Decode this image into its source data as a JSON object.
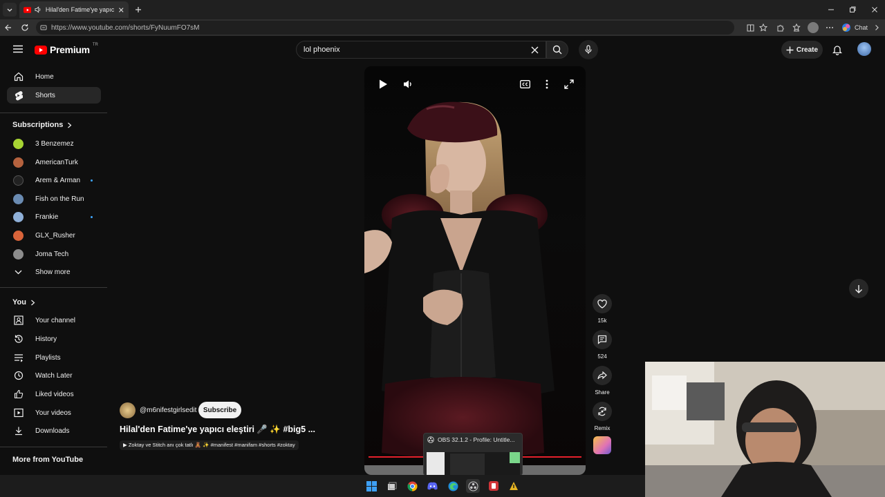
{
  "browser": {
    "tab_title": "Hilal'den Fatime'ye yapıcı eleştiri",
    "url": "https://www.youtube.com/shorts/FyNuumFO7sM",
    "chat_label": "Chat"
  },
  "header": {
    "logo_text": "Premium",
    "logo_country": "TR",
    "search_value": "lol phoenix",
    "create_label": "Create"
  },
  "sidebar": {
    "home": "Home",
    "shorts": "Shorts",
    "subscriptions_title": "Subscriptions",
    "subscriptions": [
      {
        "name": "3 Benzemez",
        "color": "#a7d433"
      },
      {
        "name": "AmericanTurk",
        "color": "#b5623e"
      },
      {
        "name": "Arem & Arman",
        "color": "#222222"
      },
      {
        "name": "Fish on the Run",
        "color": "#6a8bb2"
      },
      {
        "name": "Frankie",
        "color": "#8fb0d8"
      },
      {
        "name": "GLX_Rusher",
        "color": "#d9643a"
      },
      {
        "name": "Joma Tech",
        "color": "#8c8c8c"
      }
    ],
    "show_more": "Show more",
    "you_title": "You",
    "you_items": [
      "Your channel",
      "History",
      "Playlists",
      "Watch Later",
      "Liked videos",
      "Your videos",
      "Downloads"
    ],
    "more_from": "More from YouTube"
  },
  "short": {
    "channel": "@m6nifestgirlsedit",
    "subscribe": "Subscribe",
    "title": "Hilal'den Fatime'ye yapıcı eleştiri 🎤 ✨ #big5 ...",
    "description": "▶ Zoktay ve Stitch anı çok tatlı 🧸 ✨ #manifest #manifam #shorts #zoktay"
  },
  "actions": {
    "likes": "15k",
    "comments": "524",
    "share": "Share",
    "remix": "Remix"
  },
  "obs_tooltip": "OBS 32.1.2 - Profile: Untitle...",
  "colors": {
    "youtube_red": "#ff0000",
    "accent_blue": "#3ea6ff",
    "progress_red": "#e5202b"
  }
}
